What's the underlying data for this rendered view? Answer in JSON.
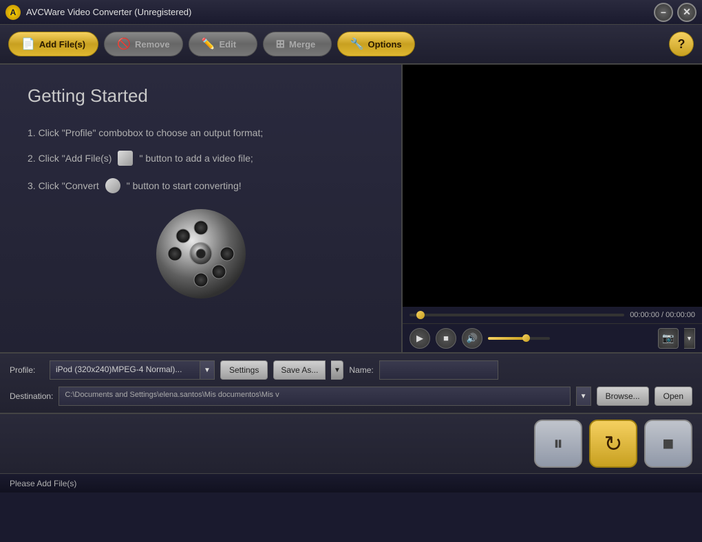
{
  "titlebar": {
    "icon_label": "A",
    "title": "AVCWare Video Converter (Unregistered)",
    "minimize_label": "−",
    "close_label": "✕"
  },
  "toolbar": {
    "add_files_label": "Add File(s)",
    "remove_label": "Remove",
    "edit_label": "Edit",
    "merge_label": "Merge",
    "options_label": "Options",
    "help_label": "?"
  },
  "getting_started": {
    "title": "Getting Started",
    "step1": "1. Click \"Profile\" combobox to choose an output format;",
    "step2": "2. Click \"Add File(s)   \" button to add a video file;",
    "step3": "3. Click \"Convert   \" button to start converting!"
  },
  "video_player": {
    "time": "00:00:00 / 00:00:00",
    "play_icon": "▶",
    "stop_icon": "■",
    "volume_icon": "🔊",
    "camera_icon": "📷"
  },
  "profile": {
    "label": "Profile:",
    "value": "iPod (320x240)MPEG-4 Normal)...",
    "settings_label": "Settings",
    "saveas_label": "Save As...",
    "name_label": "Name:"
  },
  "destination": {
    "label": "Destination:",
    "path": "C:\\Documents and Settings\\elena.santos\\Mis documentos\\Mis v",
    "browse_label": "Browse...",
    "open_label": "Open"
  },
  "convert_controls": {
    "pause_icon": "⏸",
    "convert_icon": "🔄",
    "stop_icon": "■"
  },
  "status": {
    "text": "Please Add File(s)"
  }
}
